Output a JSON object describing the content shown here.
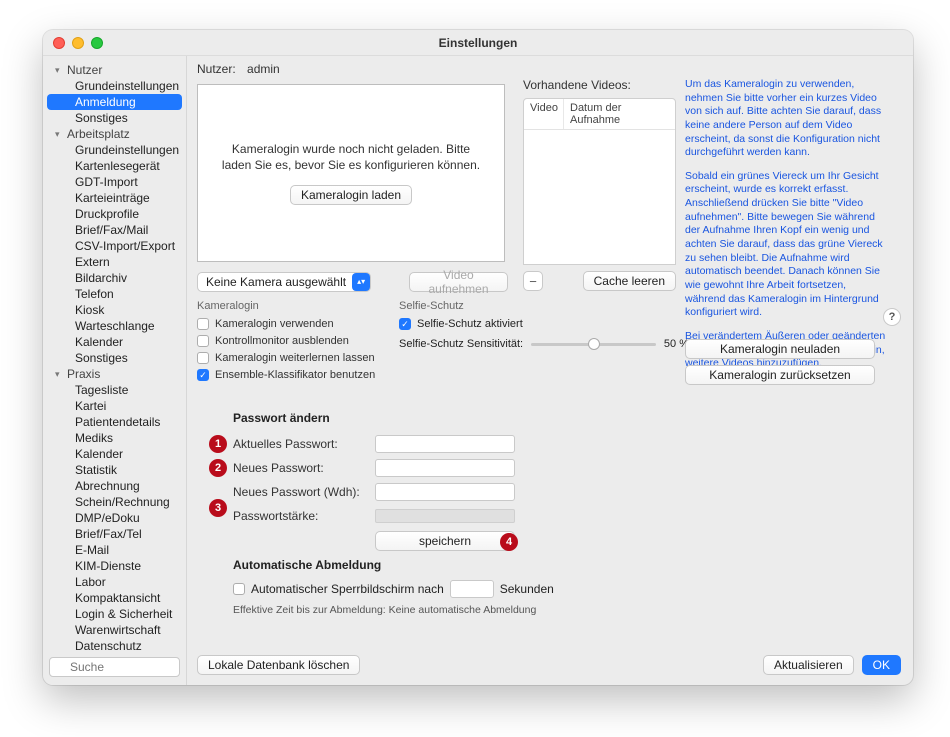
{
  "window": {
    "title": "Einstellungen"
  },
  "user": {
    "label": "Nutzer:",
    "value": "admin"
  },
  "sidebar": {
    "search_placeholder": "Suche",
    "groups": [
      {
        "label": "Nutzer",
        "items": [
          "Grundeinstellungen",
          "Anmeldung",
          "Sonstiges"
        ],
        "selected_index": 1
      },
      {
        "label": "Arbeitsplatz",
        "items": [
          "Grundeinstellungen",
          "Kartenlesegerät",
          "GDT-Import",
          "Karteieinträge",
          "Druckprofile",
          "Brief/Fax/Mail",
          "CSV-Import/Export",
          "Extern",
          "Bildarchiv",
          "Telefon",
          "Kiosk",
          "Warteschlange",
          "Kalender",
          "Sonstiges"
        ]
      },
      {
        "label": "Praxis",
        "items": [
          "Tagesliste",
          "Kartei",
          "Patientendetails",
          "Mediks",
          "Kalender",
          "Statistik",
          "Abrechnung",
          "Schein/Rechnung",
          "DMP/eDoku",
          "Brief/Fax/Tel",
          "E-Mail",
          "KIM-Dienste",
          "Labor",
          "Kompaktansicht",
          "Login & Sicherheit",
          "Warenwirtschaft",
          "Datenschutz",
          "Sonstiges"
        ]
      }
    ]
  },
  "camera": {
    "message": "Kameralogin wurde noch nicht geladen. Bitte laden Sie es, bevor Sie es konfigurieren können.",
    "load_button": "Kameralogin laden",
    "select_label": "Keine Kamera ausgewählt",
    "video_button": "Video aufnehmen"
  },
  "kameralogin_group": {
    "title": "Kameralogin",
    "c1": "Kameralogin verwenden",
    "c2": "Kontrollmonitor ausblenden",
    "c3": "Kameralogin weiterlernen lassen",
    "c4": "Ensemble-Klassifikator benutzen"
  },
  "selfie": {
    "title": "Selfie-Schutz",
    "c1": "Selfie-Schutz aktiviert",
    "sens_label": "Selfie-Schutz Sensitivität:",
    "value": "50 %"
  },
  "videos": {
    "title": "Vorhandene Videos:",
    "col1": "Video",
    "col2": "Datum der Aufnahme",
    "minus": "−",
    "cache_clear": "Cache leeren"
  },
  "help": {
    "p1": "Um das Kameralogin zu verwenden, nehmen Sie bitte vorher ein kurzes Video von sich auf. Bitte achten Sie darauf, dass keine andere Person auf dem Video erscheint, da sonst die Konfiguration nicht durchgeführt werden kann.",
    "p2": "Sobald ein grünes Viereck um Ihr Gesicht erscheint, wurde es korrekt erfasst. Anschließend drücken Sie bitte \"Video aufnehmen\". Bitte bewegen Sie während der Aufnahme Ihren Kopf ein wenig und achten Sie darauf, dass das grüne Viereck zu sehen bleibt. Die Aufnahme wird automatisch beendet. Danach können Sie wie gewohnt Ihre Arbeit fortsetzen, während das Kameralogin im Hintergrund konfiguriert wird.",
    "p3": "Bei verändertem Äußeren oder geänderten Lichtverhältnissen kann es notwendig sein, weitere Videos hinzuzufügen."
  },
  "side_buttons": {
    "reload": "Kameralogin neuladen",
    "reset": "Kameralogin zurücksetzen"
  },
  "password": {
    "title": "Passwort ändern",
    "l1": "Aktuelles Passwort:",
    "l2": "Neues Passwort:",
    "l3": "Neues Passwort (Wdh):",
    "l4": "Passwortstärke:",
    "save": "speichern"
  },
  "badges": {
    "n1": "1",
    "n2": "2",
    "n3": "3",
    "n4": "4"
  },
  "auto": {
    "title": "Automatische Abmeldung",
    "chk": "Automatischer Sperrbildschirm nach",
    "unit": "Sekunden",
    "note": "Effektive Zeit bis zur Abmeldung: Keine automatische Abmeldung"
  },
  "footer": {
    "local_db": "Lokale Datenbank löschen",
    "refresh": "Aktualisieren",
    "ok": "OK"
  },
  "help_q": "?"
}
